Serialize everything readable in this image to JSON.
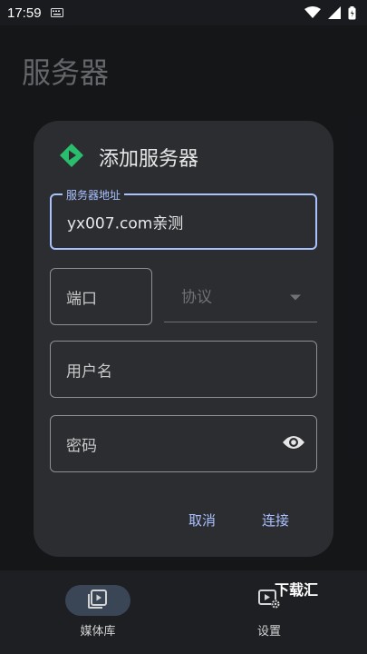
{
  "status_bar": {
    "time": "17:59",
    "icons": [
      "keyboard-icon",
      "wifi-icon",
      "signal-icon",
      "battery-icon"
    ]
  },
  "page": {
    "title": "服务器"
  },
  "dialog": {
    "title": "添加服务器",
    "address": {
      "label": "服务器地址",
      "value": "yx007.com亲测"
    },
    "port": {
      "placeholder": "端口"
    },
    "protocol": {
      "placeholder": "协议"
    },
    "username": {
      "placeholder": "用户名"
    },
    "password": {
      "placeholder": "密码"
    },
    "cancel_label": "取消",
    "connect_label": "连接"
  },
  "bottom_nav": {
    "items": [
      {
        "label": "媒体库",
        "icon": "media-library-icon",
        "active": true
      },
      {
        "label": "设置",
        "icon": "settings-icon",
        "active": false
      }
    ]
  },
  "watermark": "下载汇",
  "colors": {
    "accent": "#a9c1ff",
    "brand": "#2bbd6e",
    "dialog_bg": "#2b2d30",
    "background": "#1a1b1e"
  }
}
